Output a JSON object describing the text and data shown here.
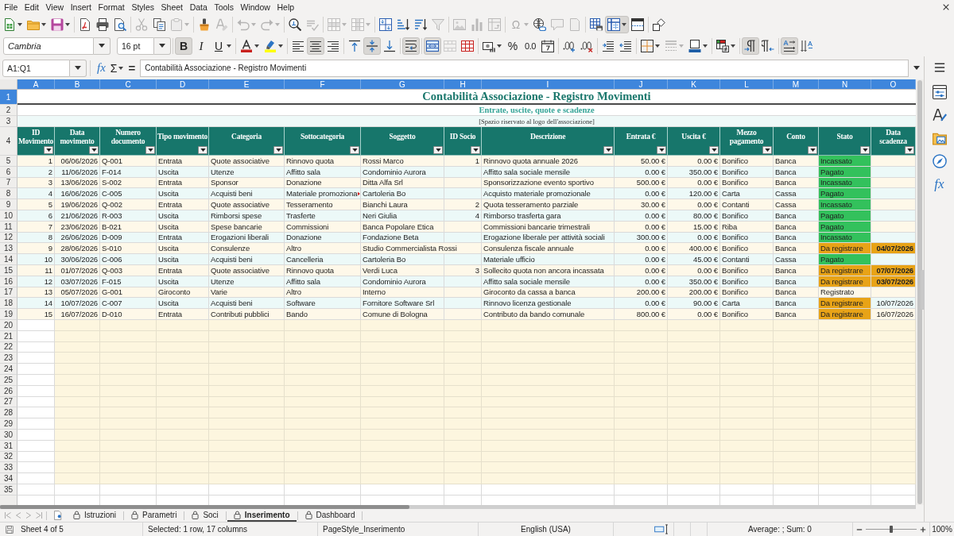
{
  "menu_bar": {
    "items": [
      "File",
      "Edit",
      "View",
      "Insert",
      "Format",
      "Styles",
      "Sheet",
      "Data",
      "Tools",
      "Window",
      "Help"
    ]
  },
  "standard_toolbar": {
    "groups": [
      [
        {
          "kind": "new",
          "on": false,
          "disabled": false
        },
        {
          "kind": "open",
          "on": false,
          "disabled": false
        },
        {
          "kind": "save",
          "on": false,
          "disabled": false
        }
      ],
      [
        {
          "kind": "pdf",
          "on": false,
          "disabled": false
        },
        {
          "kind": "print",
          "on": false,
          "disabled": false
        },
        {
          "kind": "preview",
          "on": false,
          "disabled": false
        }
      ],
      [
        {
          "kind": "cut",
          "on": false,
          "disabled": true
        },
        {
          "kind": "copy",
          "on": false,
          "disabled": false
        },
        {
          "kind": "paste",
          "on": false,
          "disabled": true
        }
      ],
      [
        {
          "kind": "clone",
          "on": false,
          "disabled": false
        },
        {
          "kind": "clear",
          "on": false,
          "disabled": true
        }
      ],
      [
        {
          "kind": "undo",
          "on": false,
          "disabled": true
        },
        {
          "kind": "redo",
          "on": false,
          "disabled": true
        }
      ],
      [
        {
          "kind": "find",
          "on": false,
          "disabled": false
        },
        {
          "kind": "spelling",
          "on": false,
          "disabled": true
        }
      ],
      [
        {
          "kind": "row",
          "on": false,
          "disabled": true
        },
        {
          "kind": "column",
          "on": false,
          "disabled": true
        }
      ],
      [
        {
          "kind": "sort",
          "on": false,
          "disabled": false
        },
        {
          "kind": "ascending",
          "on": false,
          "disabled": false
        },
        {
          "kind": "descending",
          "on": false,
          "disabled": false
        },
        {
          "kind": "autofilter",
          "on": false,
          "disabled": true
        }
      ],
      [
        {
          "kind": "image",
          "on": false,
          "disabled": true
        },
        {
          "kind": "chart",
          "on": false,
          "disabled": true
        },
        {
          "kind": "pivot",
          "on": false,
          "disabled": true
        }
      ],
      [
        {
          "kind": "special",
          "label": "Ω",
          "on": false,
          "disabled": true
        },
        {
          "kind": "hyperlink",
          "on": false,
          "disabled": false
        },
        {
          "kind": "comment",
          "on": false,
          "disabled": true
        },
        {
          "kind": "headerfooter",
          "on": false,
          "disabled": true
        }
      ],
      [
        {
          "kind": "printarea",
          "on": false,
          "disabled": false
        },
        {
          "kind": "freeze",
          "on": true,
          "disabled": false
        },
        {
          "kind": "split",
          "on": false,
          "disabled": false
        }
      ],
      [
        {
          "kind": "draw",
          "on": false,
          "disabled": false
        }
      ]
    ]
  },
  "formatting_toolbar": {
    "font_name": "Cambria",
    "font_size": "16 pt",
    "groups": [
      [
        {
          "kind": "bold",
          "label": "B",
          "on": true,
          "disabled": false
        },
        {
          "kind": "italic",
          "label": "I",
          "on": false,
          "disabled": false
        },
        {
          "kind": "underline",
          "label": "U",
          "on": false,
          "disabled": false
        }
      ],
      [
        {
          "kind": "fontcolor",
          "on": false,
          "disabled": false
        },
        {
          "kind": "highlight",
          "on": false,
          "disabled": false
        }
      ],
      [
        {
          "kind": "left",
          "on": false,
          "disabled": false
        },
        {
          "kind": "center",
          "on": true,
          "disabled": false
        },
        {
          "kind": "right",
          "on": false,
          "disabled": false
        }
      ],
      [
        {
          "kind": "top",
          "on": false,
          "disabled": false
        },
        {
          "kind": "middle",
          "on": true,
          "disabled": false
        },
        {
          "kind": "bottom",
          "on": false,
          "disabled": false
        }
      ],
      [
        {
          "kind": "wrap",
          "on": true,
          "disabled": false
        }
      ],
      [
        {
          "kind": "mergecenter",
          "on": true,
          "disabled": false
        },
        {
          "kind": "merge",
          "on": false,
          "disabled": true
        },
        {
          "kind": "unmerge",
          "on": false,
          "disabled": false
        }
      ],
      [
        {
          "kind": "currency",
          "on": false,
          "disabled": false
        },
        {
          "kind": "percent",
          "label": "%",
          "on": false,
          "disabled": false
        },
        {
          "kind": "decimal",
          "label": "0.0",
          "on": false,
          "disabled": false
        },
        {
          "kind": "date",
          "on": false,
          "disabled": false
        }
      ],
      [
        {
          "kind": "adddecimal",
          "on": false,
          "disabled": false
        },
        {
          "kind": "deldecimal",
          "on": false,
          "disabled": false
        }
      ],
      [
        {
          "kind": "indent",
          "on": false,
          "disabled": false
        },
        {
          "kind": "outdent",
          "on": false,
          "disabled": false
        }
      ],
      [
        {
          "kind": "borders",
          "on": false,
          "disabled": false
        },
        {
          "kind": "borderstyle",
          "on": false,
          "disabled": true
        },
        {
          "kind": "bordercolor",
          "on": false,
          "disabled": false
        }
      ],
      [
        {
          "kind": "conditional",
          "on": false,
          "disabled": false
        }
      ],
      [
        {
          "kind": "ltr",
          "on": true,
          "disabled": false
        },
        {
          "kind": "rtl",
          "on": false,
          "disabled": false
        }
      ],
      [
        {
          "kind": "horizontal",
          "on": true,
          "disabled": false
        },
        {
          "kind": "vertical",
          "on": false,
          "disabled": false
        }
      ]
    ]
  },
  "formula_bar": {
    "name_box": "A1:Q1",
    "function_wizard": "fx",
    "sum": "Σ",
    "formula": "=",
    "content": "Contabilità Associazione - Registro Movimenti"
  },
  "sheet": {
    "column_headers": [
      {
        "label": "A",
        "selected": true
      },
      {
        "label": "B",
        "selected": true
      },
      {
        "label": "C",
        "selected": true
      },
      {
        "label": "D",
        "selected": true
      },
      {
        "label": "E",
        "selected": true
      },
      {
        "label": "F",
        "selected": true
      },
      {
        "label": "G",
        "selected": true
      },
      {
        "label": "H",
        "selected": true
      },
      {
        "label": "I",
        "selected": true
      },
      {
        "label": "J",
        "selected": true
      },
      {
        "label": "K",
        "selected": true
      },
      {
        "label": "L",
        "selected": true
      },
      {
        "label": "M",
        "selected": true
      },
      {
        "label": "N",
        "selected": true
      },
      {
        "label": "O",
        "selected": true
      }
    ],
    "row_headers": [
      {
        "label": "1",
        "selected": true
      },
      {
        "label": "2",
        "selected": false
      },
      {
        "label": "3",
        "selected": false
      },
      {
        "label": "4",
        "selected": false
      },
      {
        "label": "5",
        "selected": false
      },
      {
        "label": "6",
        "selected": false
      },
      {
        "label": "7",
        "selected": false
      },
      {
        "label": "8",
        "selected": false
      },
      {
        "label": "9",
        "selected": false
      },
      {
        "label": "10",
        "selected": false
      },
      {
        "label": "11",
        "selected": false
      },
      {
        "label": "12",
        "selected": false
      },
      {
        "label": "13",
        "selected": false
      },
      {
        "label": "14",
        "selected": false
      },
      {
        "label": "15",
        "selected": false
      },
      {
        "label": "16",
        "selected": false
      },
      {
        "label": "17",
        "selected": false
      },
      {
        "label": "18",
        "selected": false
      },
      {
        "label": "19",
        "selected": false
      },
      {
        "label": "20",
        "selected": false
      },
      {
        "label": "21",
        "selected": false
      },
      {
        "label": "22",
        "selected": false
      },
      {
        "label": "23",
        "selected": false
      },
      {
        "label": "24",
        "selected": false
      },
      {
        "label": "25",
        "selected": false
      },
      {
        "label": "26",
        "selected": false
      },
      {
        "label": "27",
        "selected": false
      },
      {
        "label": "28",
        "selected": false
      },
      {
        "label": "29",
        "selected": false
      },
      {
        "label": "30",
        "selected": false
      },
      {
        "label": "31",
        "selected": false
      },
      {
        "label": "32",
        "selected": false
      },
      {
        "label": "33",
        "selected": false
      },
      {
        "label": "34",
        "selected": false
      },
      {
        "label": "35",
        "selected": false
      }
    ],
    "title": "Contabilità Associazione - Registro Movimenti",
    "subtitle": "Entrate, uscite, quote e scadenze",
    "logo_note": "[Spazio riservato al logo dell'associazione]",
    "columns": [
      {
        "label": "ID Movimento",
        "filter": true
      },
      {
        "label": "Data movimento",
        "filter": true
      },
      {
        "label": "Numero documento",
        "filter": true
      },
      {
        "label": "Tipo movimento",
        "filter": true
      },
      {
        "label": "Categoria",
        "filter": true
      },
      {
        "label": "Sottocategoria",
        "filter": true
      },
      {
        "label": "Soggetto",
        "filter": true
      },
      {
        "label": "ID Socio",
        "filter": true
      },
      {
        "label": "Descrizione",
        "filter": true
      },
      {
        "label": "Entrata €",
        "filter": true
      },
      {
        "label": "Uscita €",
        "filter": true
      },
      {
        "label": "Mezzo pagamento",
        "filter": true
      },
      {
        "label": "Conto",
        "filter": true
      },
      {
        "label": "Stato",
        "filter": true
      },
      {
        "label": "Data scadenza",
        "filter": true
      }
    ],
    "rows": [
      {
        "id": "1",
        "date": "06/06/2026",
        "document": "Q-001",
        "type": "Entrata",
        "category": "Quote associative",
        "subcategory": "Rinnovo quota",
        "subcategory_clipped": false,
        "party": "Rossi Marco",
        "member_id": "1",
        "description": "Rinnovo quota annuale 2026",
        "income": "50.00 €",
        "expense": "0.00 €",
        "payment_method": "Bonifico",
        "account": "Banca",
        "status": {
          "text": "Incassato",
          "color": "#33c15c"
        }
      },
      {
        "id": "2",
        "date": "11/06/2026",
        "document": "F-014",
        "type": "Uscita",
        "category": "Utenze",
        "subcategory": "Affitto sala",
        "subcategory_clipped": false,
        "party": "Condominio Aurora",
        "description": "Affitto sala sociale mensile",
        "income": "0.00 €",
        "expense": "350.00 €",
        "payment_method": "Bonifico",
        "account": "Banca",
        "status": {
          "text": "Pagato",
          "color": "#33c15c"
        }
      },
      {
        "id": "3",
        "date": "13/06/2026",
        "document": "S-002",
        "type": "Entrata",
        "category": "Sponsor",
        "subcategory": "Donazione",
        "subcategory_clipped": false,
        "party": "Ditta Alfa Srl",
        "description": "Sponsorizzazione evento sportivo",
        "income": "500.00 €",
        "expense": "0.00 €",
        "payment_method": "Bonifico",
        "account": "Banca",
        "status": {
          "text": "Incassato",
          "color": "#33c15c"
        }
      },
      {
        "id": "4",
        "date": "16/06/2026",
        "document": "C-005",
        "type": "Uscita",
        "category": "Acquisti beni",
        "subcategory": "Materiale promoziona",
        "subcategory_clipped": true,
        "party": "Cartoleria Bo",
        "description": "Acquisto materiale promozionale",
        "income": "0.00 €",
        "expense": "120.00 €",
        "payment_method": "Carta",
        "account": "Cassa",
        "status": {
          "text": "Pagato",
          "color": "#33c15c"
        }
      },
      {
        "id": "5",
        "date": "19/06/2026",
        "document": "Q-002",
        "type": "Entrata",
        "category": "Quote associative",
        "subcategory": "Tesseramento",
        "subcategory_clipped": false,
        "party": "Bianchi Laura",
        "member_id": "2",
        "description": "Quota tesseramento parziale",
        "income": "30.00 €",
        "expense": "0.00 €",
        "payment_method": "Contanti",
        "account": "Cassa",
        "status": {
          "text": "Incassato",
          "color": "#33c15c"
        }
      },
      {
        "id": "6",
        "date": "21/06/2026",
        "document": "R-003",
        "type": "Uscita",
        "category": "Rimborsi spese",
        "subcategory": "Trasferte",
        "subcategory_clipped": false,
        "party": "Neri Giulia",
        "member_id": "4",
        "description": "Rimborso trasferta gara",
        "income": "0.00 €",
        "expense": "80.00 €",
        "payment_method": "Bonifico",
        "account": "Banca",
        "status": {
          "text": "Pagato",
          "color": "#33c15c"
        }
      },
      {
        "id": "7",
        "date": "23/06/2026",
        "document": "B-021",
        "type": "Uscita",
        "category": "Spese bancarie",
        "subcategory": "Commissioni",
        "subcategory_clipped": false,
        "party": "Banca Popolare Etica",
        "description": "Commissioni bancarie trimestrali",
        "income": "0.00 €",
        "expense": "15.00 €",
        "payment_method": "Riba",
        "account": "Banca",
        "status": {
          "text": "Pagato",
          "color": "#33c15c"
        }
      },
      {
        "id": "8",
        "date": "26/06/2026",
        "document": "D-009",
        "type": "Entrata",
        "category": "Erogazioni liberali",
        "subcategory": "Donazione",
        "subcategory_clipped": false,
        "party": "Fondazione Beta",
        "description": "Erogazione liberale per attività sociali",
        "income": "300.00 €",
        "expense": "0.00 €",
        "payment_method": "Bonifico",
        "account": "Banca",
        "status": {
          "text": "Incassato",
          "color": "#33c15c"
        }
      },
      {
        "id": "9",
        "date": "28/06/2026",
        "document": "S-010",
        "type": "Uscita",
        "category": "Consulenze",
        "subcategory": "Altro",
        "subcategory_clipped": false,
        "party": "Studio Commercialista Rossi",
        "description": "Consulenza fiscale annuale",
        "income": "0.00 €",
        "expense": "400.00 €",
        "payment_method": "Bonifico",
        "account": "Banca",
        "status": {
          "text": "Da registrare",
          "color": "#e8a317"
        },
        "due_date": {
          "text": "04/07/2026",
          "color": "#e8a317"
        }
      },
      {
        "id": "10",
        "date": "30/06/2026",
        "document": "C-006",
        "type": "Uscita",
        "category": "Acquisti beni",
        "subcategory": "Cancelleria",
        "subcategory_clipped": false,
        "party": "Cartoleria Bo",
        "description": "Materiale ufficio",
        "income": "0.00 €",
        "expense": "45.00 €",
        "payment_method": "Contanti",
        "account": "Cassa",
        "status": {
          "text": "Pagato",
          "color": "#33c15c"
        }
      },
      {
        "id": "11",
        "date": "01/07/2026",
        "document": "Q-003",
        "type": "Entrata",
        "category": "Quote associative",
        "subcategory": "Rinnovo quota",
        "subcategory_clipped": false,
        "party": "Verdi Luca",
        "member_id": "3",
        "description": "Sollecito quota non ancora incassata",
        "income": "0.00 €",
        "expense": "0.00 €",
        "payment_method": "Bonifico",
        "account": "Banca",
        "status": {
          "text": "Da registrare",
          "color": "#e8a317"
        },
        "due_date": {
          "text": "07/07/2026",
          "color": "#e8a317"
        }
      },
      {
        "id": "12",
        "date": "03/07/2026",
        "document": "F-015",
        "type": "Uscita",
        "category": "Utenze",
        "subcategory": "Affitto sala",
        "subcategory_clipped": false,
        "party": "Condominio Aurora",
        "description": "Affitto sala sociale mensile",
        "income": "0.00 €",
        "expense": "350.00 €",
        "payment_method": "Bonifico",
        "account": "Banca",
        "status": {
          "text": "Da registrare",
          "color": "#e8a317"
        },
        "due_date": {
          "text": "03/07/2026",
          "color": "#e8a317"
        }
      },
      {
        "id": "13",
        "date": "05/07/2026",
        "document": "G-001",
        "type": "Giroconto",
        "category": "Varie",
        "subcategory": "Altro",
        "subcategory_clipped": false,
        "party": "Interno",
        "description": "Giroconto da cassa a banca",
        "income": "200.00 €",
        "expense": "200.00 €",
        "payment_method": "Bonifico",
        "account": "Banca",
        "status": {
          "text": "Registrato"
        }
      },
      {
        "id": "14",
        "date": "10/07/2026",
        "document": "C-007",
        "type": "Uscita",
        "category": "Acquisti beni",
        "subcategory": "Software",
        "subcategory_clipped": false,
        "party": "Fornitore Software Srl",
        "description": "Rinnovo licenza gestionale",
        "income": "0.00 €",
        "expense": "90.00 €",
        "payment_method": "Carta",
        "account": "Banca",
        "status": {
          "text": "Da registrare",
          "color": "#e8a317"
        },
        "due_date": {
          "text": "10/07/2026"
        }
      },
      {
        "id": "15",
        "date": "16/07/2026",
        "document": "D-010",
        "type": "Entrata",
        "category": "Contributi pubblici",
        "subcategory": "Bando",
        "subcategory_clipped": false,
        "party": "Comune di Bologna",
        "description": "Contributo da bando comunale",
        "income": "800.00 €",
        "expense": "0.00 €",
        "payment_method": "Bonifico",
        "account": "Banca",
        "status": {
          "text": "Da registrare",
          "color": "#e8a317"
        },
        "due_date": {
          "text": "16/07/2026"
        }
      }
    ]
  },
  "sidebar": {
    "panels": [
      {
        "kind": "properties",
        "selected": false
      },
      {
        "kind": "styles",
        "selected": false
      },
      {
        "kind": "gallery",
        "selected": false
      },
      {
        "kind": "navigator",
        "selected": false
      },
      {
        "kind": "functions",
        "label": "fx",
        "selected": false
      }
    ]
  },
  "sheet_tabs": {
    "navigation": [
      {
        "kind": "first",
        "disabled": true
      },
      {
        "kind": "previous",
        "disabled": true
      },
      {
        "kind": "next",
        "disabled": true
      },
      {
        "kind": "last",
        "disabled": true
      }
    ],
    "tabs": [
      {
        "label": "Istruzioni",
        "selected": false,
        "protected": true
      },
      {
        "label": "Parametri",
        "selected": false,
        "protected": true
      },
      {
        "label": "Soci",
        "selected": false,
        "protected": true
      },
      {
        "label": "Inserimento",
        "selected": true,
        "protected": true
      },
      {
        "label": "Dashboard",
        "selected": false,
        "protected": true
      }
    ]
  },
  "status_bar": {
    "sheet": "Sheet 4 of 5",
    "selection": "Selected: 1 row, 17 columns",
    "page_style": "PageStyle_Inserimento",
    "language": "English (USA)",
    "summary": "Average: ; Sum: 0",
    "zoom": {
      "level": 0.5,
      "reading": "100%"
    }
  }
}
